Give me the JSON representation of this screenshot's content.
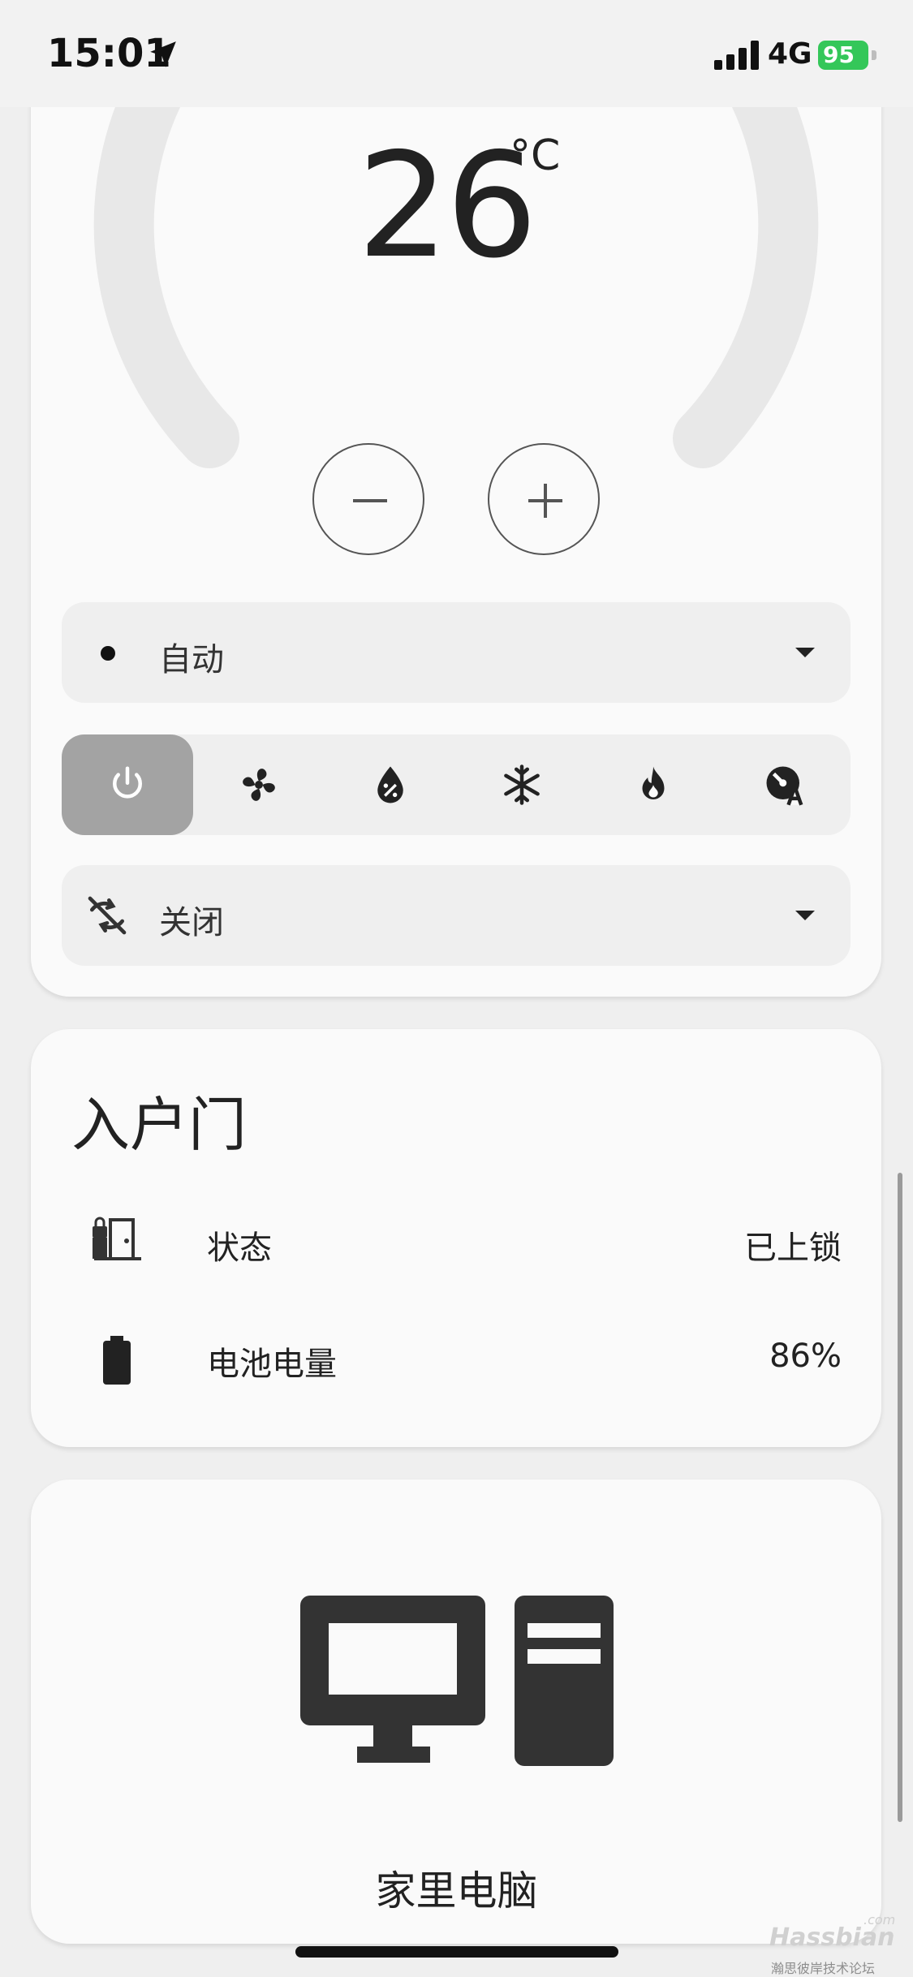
{
  "status_bar": {
    "time": "15:01",
    "network": "4G",
    "battery": "95"
  },
  "climate": {
    "temperature": "26",
    "unit": "°C",
    "mode_select": {
      "value": "自动"
    },
    "hvac_modes": [
      {
        "name": "power-icon",
        "active": true
      },
      {
        "name": "fan-icon",
        "active": false
      },
      {
        "name": "dry-icon",
        "active": false
      },
      {
        "name": "snowflake-icon",
        "active": false
      },
      {
        "name": "fire-icon",
        "active": false
      },
      {
        "name": "auto-mode-icon",
        "active": false
      }
    ],
    "swing_select": {
      "value": "关闭"
    }
  },
  "door": {
    "title": "入户门",
    "rows": [
      {
        "icon": "door-lock-icon",
        "label": "状态",
        "value": "已上锁"
      },
      {
        "icon": "battery-icon",
        "label": "电池电量",
        "value": "86%"
      }
    ]
  },
  "pc": {
    "name": "家里电脑",
    "icon": "desktop-computer-icon"
  },
  "watermark": {
    "brand": "Hassbian",
    "sub": "瀚思彼岸技术论坛",
    "domain": ".com"
  },
  "colors": {
    "active_mode": "#a3a3a3",
    "battery": "#34c759",
    "card": "#fafafa",
    "page": "#efefef"
  }
}
